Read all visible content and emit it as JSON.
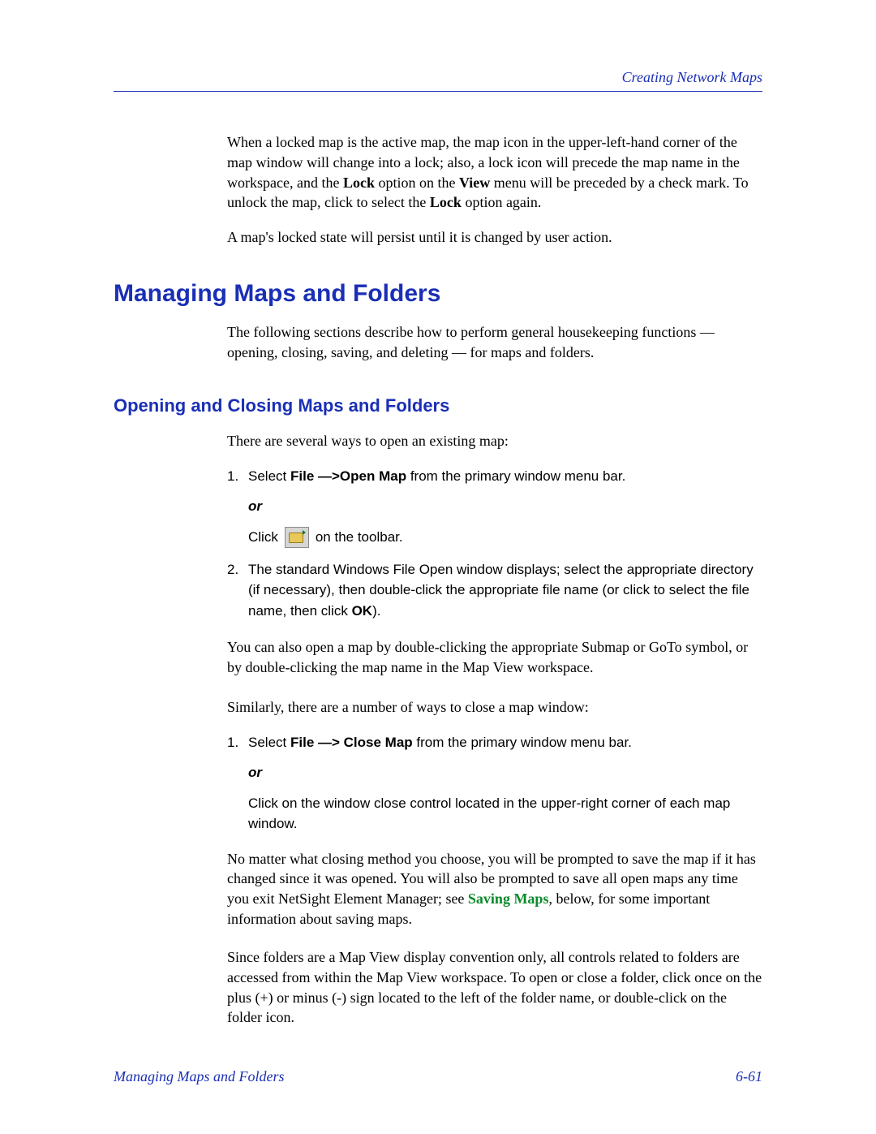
{
  "header": {
    "title": "Creating Network Maps"
  },
  "intro": {
    "p1_a": "When a locked map is the active map, the map icon in the upper-left-hand corner of the map window will change into a lock; also, a lock icon will precede the map name in the workspace, and the ",
    "p1_lock1": "Lock",
    "p1_b": " option on the ",
    "p1_view": "View",
    "p1_c": " menu will be preceded by a check mark. To unlock the map, click to select the ",
    "p1_lock2": "Lock",
    "p1_d": " option again.",
    "p2": "A map's locked state will persist until it is changed by user action."
  },
  "h1": "Managing Maps and Folders",
  "sec1_intro": "The following sections describe how to perform general housekeeping functions — opening, closing, saving, and deleting — for maps and folders.",
  "h2": "Opening and Closing Maps and Folders",
  "open": {
    "intro": "There are several ways to open an existing map:",
    "step1_a": "Select ",
    "step1_b": "File —>Open Map",
    "step1_c": " from the primary window menu bar.",
    "or": "or",
    "click_a": "Click",
    "click_b": "on the toolbar.",
    "step2_a": "The standard Windows File Open window displays; select the appropriate directory (if necessary), then double-click the appropriate file name (or click to select the file name, then click ",
    "step2_ok": "OK",
    "step2_b": ").",
    "after": "You can also open a map by double-clicking the appropriate Submap or GoTo symbol, or by double-clicking the map name in the Map View workspace."
  },
  "close": {
    "intro": "Similarly, there are a number of ways to close a map window:",
    "step1_a": "Select ",
    "step1_b": "File —> Close Map",
    "step1_c": " from the primary window menu bar.",
    "or": "or",
    "alt": "Click on the window close control located in the upper-right corner of each map window.",
    "after_a": "No matter what closing method you choose, you will be prompted to save the map if it has changed since it was opened. You will also be prompted to save all open maps any time you exit NetSight Element Manager; see ",
    "after_link": "Saving Maps",
    "after_b": ", below, for some important information about saving maps.",
    "folders": "Since folders are a Map View display convention only, all controls related to folders are accessed from within the Map View workspace. To open or close a folder, click once on the plus (+) or minus (-) sign located to the left of the folder name, or double-click on the folder icon."
  },
  "footer": {
    "left": "Managing Maps and Folders",
    "right": "6-61"
  }
}
